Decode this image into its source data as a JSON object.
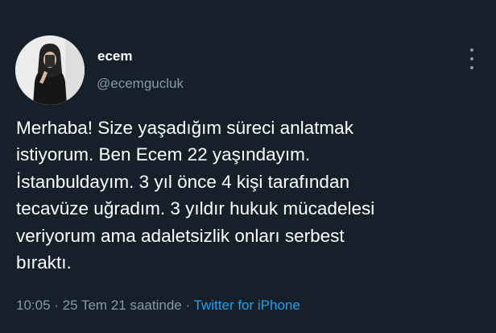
{
  "user": {
    "display_name": "ecem",
    "handle": "@ecemgucluk"
  },
  "tweet": {
    "lines": [
      "Merhaba! Size yaşadığım süreci anlatmak",
      "istiyorum. Ben Ecem 22 yaşındayım.",
      "İstanbuldayım. 3 yıl önce 4 kişi tarafından",
      "tecavüze uğradım. 3 yıldır hukuk mücadelesi",
      "veriyorum ama adaletsizlik onları serbest",
      "bıraktı."
    ]
  },
  "meta": {
    "time": "10:05",
    "separator": " · ",
    "date": "25 Tem 21 saatinde",
    "source": "Twitter for iPhone"
  },
  "icons": {
    "more": "more-vertical-icon",
    "avatar": "profile-photo"
  },
  "colors": {
    "background": "#15202b",
    "secondary_text": "#8899a6",
    "link": "#1da1f2"
  }
}
